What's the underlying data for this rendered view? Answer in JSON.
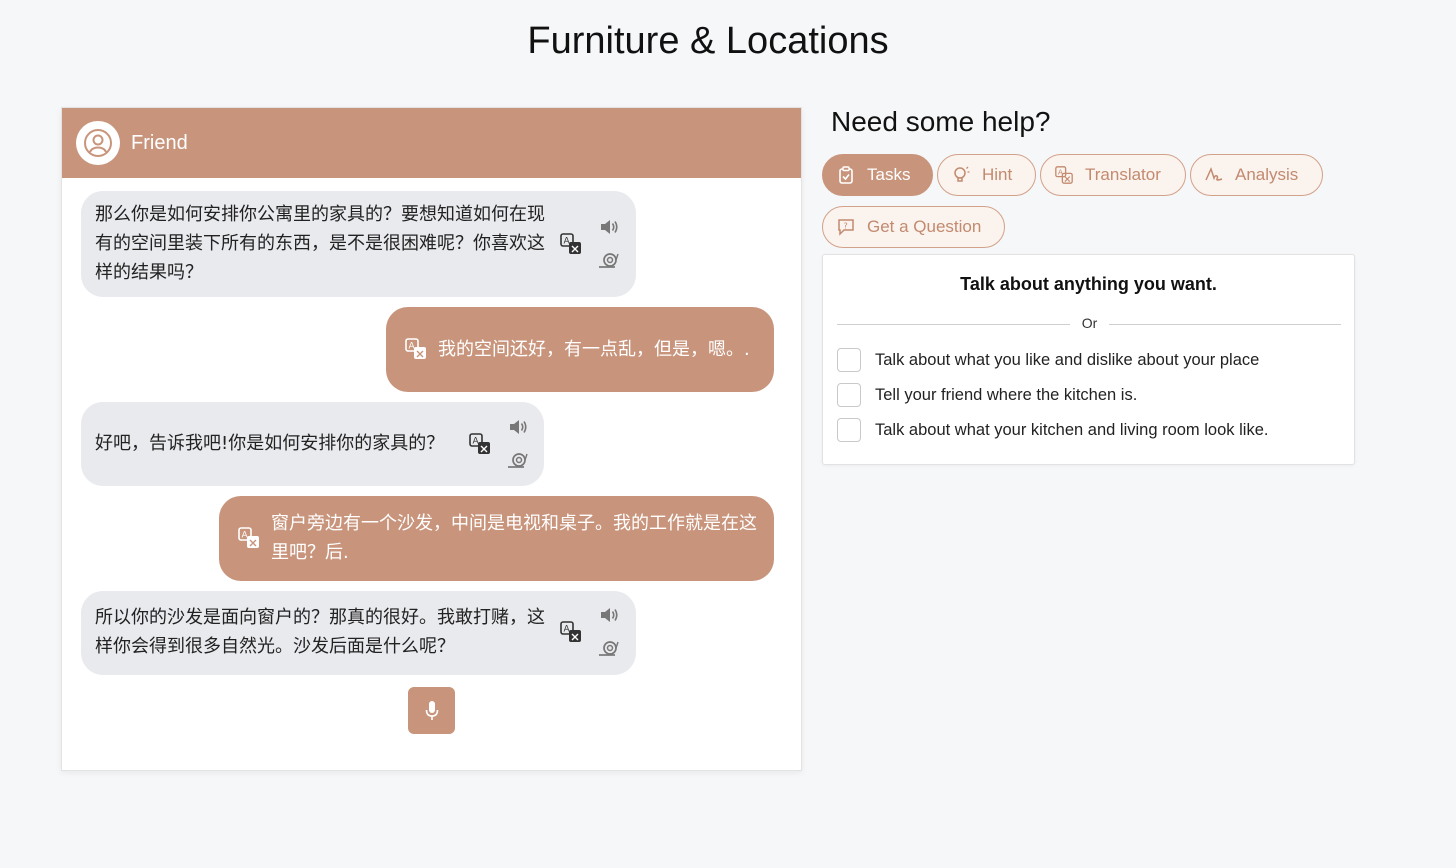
{
  "page": {
    "title": "Furniture & Locations"
  },
  "chat": {
    "header_name": "Friend",
    "messages": [
      {
        "sender": "friend",
        "text": "那么你是如何安排你公寓里的家具的？要想知道如何在现有的空间里装下所有的东西，是不是很困难呢？你喜欢这样的结果吗？"
      },
      {
        "sender": "user",
        "text": "我的空间还好，有一点乱，但是，嗯。."
      },
      {
        "sender": "friend",
        "text": "好吧，告诉我吧!你是如何安排你的家具的？"
      },
      {
        "sender": "user",
        "text": "窗户旁边有一个沙发，中间是电视和桌子。我的工作就是在这里吧？后."
      },
      {
        "sender": "friend",
        "text": "所以你的沙发是面向窗户的？那真的很好。我敢打赌，这样你会得到很多自然光。沙发后面是什么呢？"
      }
    ]
  },
  "help": {
    "title": "Need some help?",
    "buttons": [
      {
        "label": "Tasks",
        "icon": "clipboard-check-icon",
        "active": true
      },
      {
        "label": "Hint",
        "icon": "lightbulb-icon",
        "active": false
      },
      {
        "label": "Translator",
        "icon": "translate-icon",
        "active": false
      },
      {
        "label": "Analysis",
        "icon": "signature-icon",
        "active": false
      },
      {
        "label": "Get a Question",
        "icon": "question-message-icon",
        "active": false
      }
    ],
    "tasks": {
      "heading": "Talk about anything you want.",
      "or_label": "Or",
      "items": [
        {
          "label": "Talk about what you like and dislike about your place",
          "checked": false
        },
        {
          "label": "Tell your friend where the kitchen is.",
          "checked": false
        },
        {
          "label": "Talk about what your kitchen and living room look like.",
          "checked": false
        }
      ]
    }
  },
  "colors": {
    "accent": "#c8957c",
    "bubble_gray": "#e9eaed",
    "page_bg": "#f6f7f9"
  }
}
